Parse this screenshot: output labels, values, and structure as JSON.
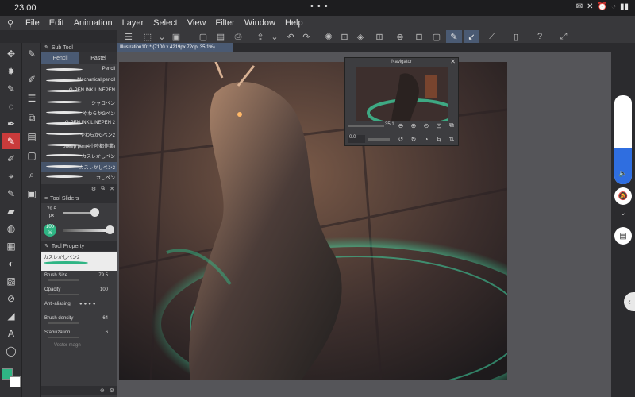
{
  "status": {
    "time": "23.00",
    "dots": "• • •",
    "battery": "▮▮"
  },
  "menu": [
    "File",
    "Edit",
    "Animation",
    "Layer",
    "Select",
    "View",
    "Filter",
    "Window",
    "Help"
  ],
  "subtool": {
    "header": "Sub Tool",
    "tabs": [
      "Pencil",
      "Pastel"
    ],
    "brushes": [
      "Pencil",
      "Mechanical pencil",
      "G-PEN INK LINEPEN",
      "シャコペン",
      "やわらかGペン",
      "G-PEN INK LINEPEN 2",
      "やわらかGペン2",
      "Sheep pen(4小時都作業)",
      "カスレかしペン",
      "カスレかしペン2",
      "カしペン"
    ],
    "active_index": 9
  },
  "tool_sliders": {
    "header": "Tool Sliders",
    "size_value": "79.5",
    "size_unit": "px",
    "opacity_value": "100",
    "opacity_unit": "%"
  },
  "tool_property": {
    "header": "Tool Property",
    "brush_name": "カスレかしペン2",
    "brush_size_label": "Brush Size",
    "brush_size_value": "79.5",
    "opacity_label": "Opacity",
    "opacity_value": "100",
    "anti_aliasing_label": "Anti-aliasing",
    "brush_density_label": "Brush density",
    "brush_density_value": "64",
    "stabilization_label": "Stabilization",
    "stabilization_value": "6",
    "vector_magnet_label": "Vector magn"
  },
  "canvas": {
    "tab_title": "Illustration101* (7100 x 4219px 72dpi 35.1%)"
  },
  "navigator": {
    "title": "Navigator",
    "zoom_value": "35.1",
    "rotate_value": "0.0"
  },
  "colors": {
    "main": "#2fb584",
    "sub": "#ffffff",
    "accent": "#4a5a73",
    "pen_active": "#c93b3b"
  },
  "volume": {
    "level_percent": 40
  }
}
